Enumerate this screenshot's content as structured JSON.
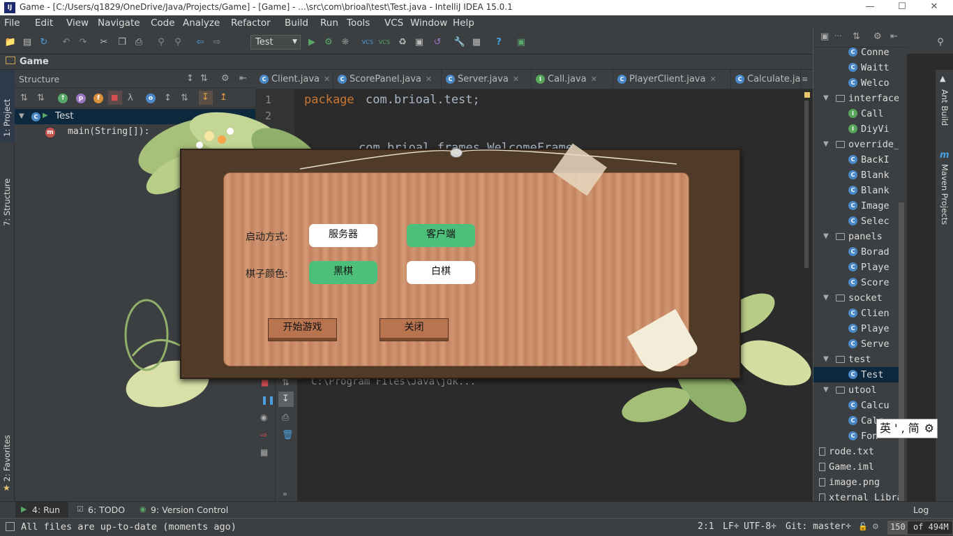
{
  "window": {
    "title": "Game - [C:/Users/q1829/OneDrive/Java/Projects/Game] - [Game] - ...\\src\\com\\brioal\\test\\Test.java - IntelliJ IDEA 15.0.1",
    "logo": "IJ",
    "minimize_icon": "minimize-icon",
    "maximize_icon": "maximize-icon",
    "close_icon": "close-icon"
  },
  "menu": [
    "File",
    "Edit",
    "View",
    "Navigate",
    "Code",
    "Analyze",
    "Refactor",
    "Build",
    "Run",
    "Tools",
    "VCS",
    "Window",
    "Help"
  ],
  "toolbar": {
    "run_config": "Test",
    "vcs_label": "VCS"
  },
  "nav": {
    "project": "Game"
  },
  "left_stripe": {
    "project_tab": "1: Project",
    "structure_tab": "7: Structure",
    "favorites_tab": "2: Favorites"
  },
  "structure": {
    "title": "Structure",
    "root": "Test",
    "method": "main(String[]):"
  },
  "editor_tabs": [
    "Client.java",
    "ScorePanel.java",
    "Server.java",
    "Call.java",
    "PlayerClient.java",
    "Calculate.java"
  ],
  "tab_icons": [
    "C",
    "C",
    "C",
    "I",
    "C",
    "C"
  ],
  "editor": {
    "line_numbers": [
      "1",
      "2"
    ],
    "keyword": "package",
    "package_name": "com.brioal.test;",
    "import_line": "com.brioal.frames.WelcomeFrame"
  },
  "run_panel": {
    "output": "C:\\Program Files\\Java\\jdk..."
  },
  "project_tree": [
    {
      "type": "class",
      "label": "Conne",
      "indent": 2
    },
    {
      "type": "class",
      "label": "Waitt",
      "indent": 2
    },
    {
      "type": "class",
      "label": "Welco",
      "indent": 2
    },
    {
      "type": "folder",
      "label": "interface",
      "indent": 1
    },
    {
      "type": "interface",
      "label": "Call",
      "indent": 2
    },
    {
      "type": "interface",
      "label": "DiyVi",
      "indent": 2
    },
    {
      "type": "folder",
      "label": "override_",
      "indent": 1
    },
    {
      "type": "class",
      "label": "BackI",
      "indent": 2
    },
    {
      "type": "class",
      "label": "Blank",
      "indent": 2
    },
    {
      "type": "class",
      "label": "Blank",
      "indent": 2
    },
    {
      "type": "class",
      "label": "Image",
      "indent": 2
    },
    {
      "type": "class",
      "label": "Selec",
      "indent": 2
    },
    {
      "type": "folder",
      "label": "panels",
      "indent": 1
    },
    {
      "type": "class",
      "label": "Borad",
      "indent": 2
    },
    {
      "type": "class",
      "label": "Playe",
      "indent": 2
    },
    {
      "type": "class",
      "label": "Score",
      "indent": 2
    },
    {
      "type": "folder",
      "label": "socket",
      "indent": 1
    },
    {
      "type": "class",
      "label": "Clien",
      "indent": 2
    },
    {
      "type": "class",
      "label": "Playe",
      "indent": 2
    },
    {
      "type": "class",
      "label": "Serve",
      "indent": 2
    },
    {
      "type": "folder",
      "label": "test",
      "indent": 1
    },
    {
      "type": "class",
      "label": "Test",
      "indent": 2
    },
    {
      "type": "folder",
      "label": "utool",
      "indent": 1
    },
    {
      "type": "class",
      "label": "Calcu",
      "indent": 2
    },
    {
      "type": "class",
      "label": "Calc",
      "indent": 2
    },
    {
      "type": "class",
      "label": "Fon",
      "indent": 2
    },
    {
      "type": "file",
      "label": "rode.txt",
      "indent": 0
    },
    {
      "type": "file",
      "label": "Game.iml",
      "indent": 0
    },
    {
      "type": "file",
      "label": "image.png",
      "indent": 0
    },
    {
      "type": "file",
      "label": "xternal Librarie",
      "indent": 0
    }
  ],
  "right_stripe": {
    "ant_tab": "Ant Build",
    "maven_tab": "Maven Projects"
  },
  "bottom_tools": {
    "run": "4: Run",
    "todo": "6: TODO",
    "vcs": "9: Version Control",
    "log": "Log"
  },
  "status": {
    "message": "All files are up-to-date (moments ago)",
    "position": "2:1",
    "line_sep": "LF÷",
    "encoding": "UTF-8÷",
    "git": "Git: master÷",
    "memory_used": "150",
    "memory_total": "of 494M"
  },
  "game_dialog": {
    "start_mode_label": "启动方式:",
    "server_button": "服务器",
    "client_button": "客户端",
    "color_label": "棋子颜色:",
    "black_button": "黑棋",
    "white_button": "白棋",
    "start_game_button": "开始游戏",
    "close_button": "关闭"
  },
  "ime": {
    "text": "英 ' , 简",
    "gear_icon": "gear-icon"
  },
  "colors": {
    "ide_bg": "#2b2b2b",
    "panel_bg": "#3c3f41",
    "green_button": "#4cc07a",
    "wood": "#c98a63"
  }
}
